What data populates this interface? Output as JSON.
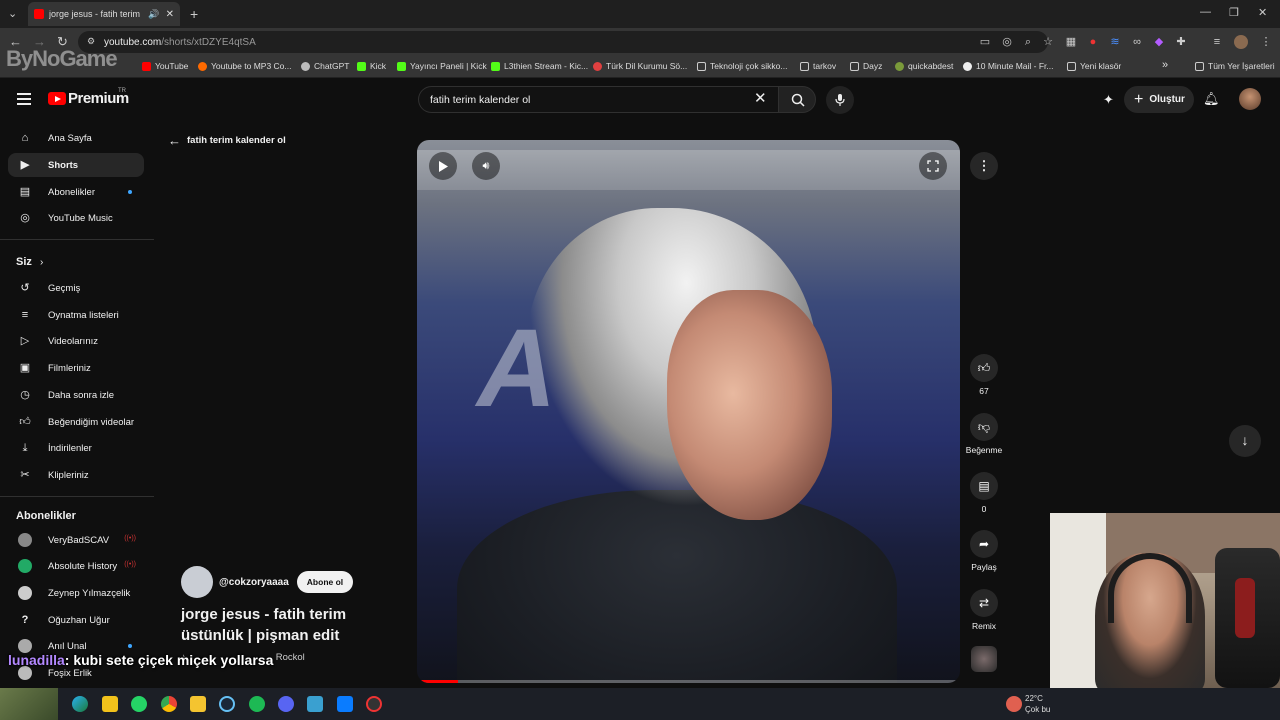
{
  "browser": {
    "tab_title": "jorge jesus - fatih terim üstü",
    "url_host": "youtube.com",
    "url_path": "/shorts/xtDZYE4qtSA",
    "bookmarks": [
      {
        "label": "YouTube",
        "color": "#ff0000"
      },
      {
        "label": "Youtube to MP3 Co...",
        "color": "#ff6a00"
      },
      {
        "label": "ChatGPT",
        "color": "#bbbbbb"
      },
      {
        "label": "Kick",
        "color": "#53fc18"
      },
      {
        "label": "Yayıncı Paneli | Kick",
        "color": "#53fc18"
      },
      {
        "label": "L3thien Stream - Kic...",
        "color": "#53fc18"
      },
      {
        "label": "Türk Dil Kurumu Sö...",
        "color": "#e04040"
      },
      {
        "label": "Teknoloji çok sikko...",
        "color": "folder"
      },
      {
        "label": "tarkov",
        "color": "folder"
      },
      {
        "label": "Dayz",
        "color": "folder"
      },
      {
        "label": "quickabdest",
        "color": "#7a9a3a"
      },
      {
        "label": "10 Minute Mail - Fr...",
        "color": "#eeeeee"
      },
      {
        "label": "Yeni klasör",
        "color": "folder"
      }
    ],
    "bookmarks_more": "»",
    "all_bookmarks": "Tüm Yer İşaretleri"
  },
  "overlay_logo": "ByNoGame",
  "youtube": {
    "brand": "Premium",
    "brand_region": "TR",
    "search_value": "fatih terim kalender ol",
    "create_label": "Oluştur",
    "sidebar": {
      "main": [
        {
          "label": "Ana Sayfa",
          "icon": "home-icon"
        },
        {
          "label": "Shorts",
          "icon": "shorts-icon"
        },
        {
          "label": "Abonelikler",
          "icon": "subscriptions-icon"
        },
        {
          "label": "YouTube Music",
          "icon": "music-icon"
        }
      ],
      "you_heading": "Siz",
      "you": [
        {
          "label": "Geçmiş",
          "icon": "history-icon"
        },
        {
          "label": "Oynatma listeleri",
          "icon": "playlists-icon"
        },
        {
          "label": "Videolarınız",
          "icon": "your-videos-icon"
        },
        {
          "label": "Filmleriniz",
          "icon": "movies-icon"
        },
        {
          "label": "Daha sonra izle",
          "icon": "watch-later-icon"
        },
        {
          "label": "Beğendiğim videolar",
          "icon": "liked-icon"
        },
        {
          "label": "İndirilenler",
          "icon": "downloads-icon"
        },
        {
          "label": "Klipleriniz",
          "icon": "clips-icon"
        }
      ],
      "subs_heading": "Abonelikler",
      "subs": [
        {
          "label": "VeryBadSCAV",
          "color": "#888888"
        },
        {
          "label": "Absolute History",
          "color": "#22aa66"
        },
        {
          "label": "Zeynep Yılmazçelik",
          "color": "#cccccc"
        },
        {
          "label": "Oğuzhan Uğur",
          "color": "#eeeeee"
        },
        {
          "label": "Anıl Unal",
          "color": "#aaaaaa"
        },
        {
          "label": "Foşix Erlik",
          "color": "#bbbbbb"
        }
      ]
    },
    "back_label": "fatih terim kalender ol",
    "video": {
      "progress": 0.075,
      "channel": "@cokzoryaaaa",
      "subscribe_label": "Abone ol",
      "title": "jorge jesus - fatih terim üstünlük | pişman edit",
      "music": "Rockol"
    },
    "actions": {
      "likes": "67",
      "dislike_label": "Beğenme",
      "comments": "0",
      "share_label": "Paylaş",
      "remix_label": "Remix"
    }
  },
  "chat_overlay": {
    "user": "lunadilla",
    "message": ": kubi sete çiçek miçek yollarsa"
  },
  "taskbar": {
    "temperature": "22°C",
    "weather": "Çok bu"
  }
}
